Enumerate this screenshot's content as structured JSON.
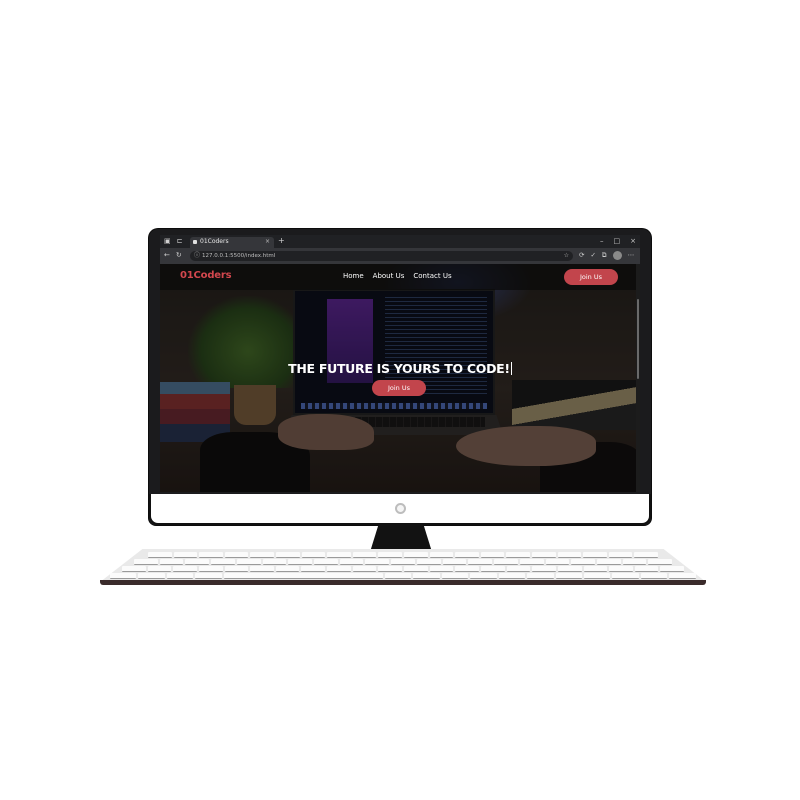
{
  "browser": {
    "tab_title": "01Coders",
    "tab_close": "×",
    "new_tab": "+",
    "url": "127.0.0.1:5500/index.html",
    "window_controls": [
      "–",
      "□",
      "×"
    ],
    "icons": [
      "tab-actions-icon",
      "tab-search-icon",
      "back-icon",
      "reload-icon",
      "lock-icon",
      "star-icon",
      "extensions-icon",
      "profile-icon",
      "menu-icon"
    ]
  },
  "site": {
    "logo": "01Coders",
    "nav": [
      {
        "label": "Home"
      },
      {
        "label": "About Us"
      },
      {
        "label": "Contact Us"
      }
    ],
    "nav_cta": "Join Us",
    "hero": {
      "title": "THE FUTURE IS YOURS TO CODE!",
      "cta": "Join Us"
    },
    "accent_color": "#c2454c"
  }
}
